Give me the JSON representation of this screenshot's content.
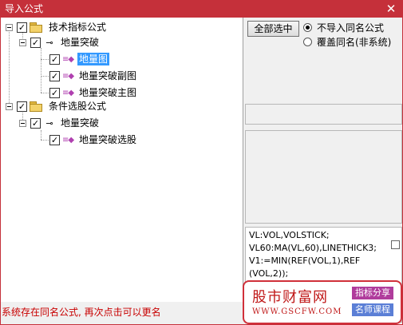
{
  "window": {
    "title": "导入公式",
    "close_glyph": "✕"
  },
  "tree": {
    "nodes": [
      {
        "label": "技术指标公式",
        "checked": true,
        "icon": "folder-icon"
      },
      {
        "label": "地量突破",
        "checked": true,
        "icon": "key-icon"
      },
      {
        "label": "地量图",
        "checked": true,
        "icon": "formula-icon",
        "selected": true
      },
      {
        "label": "地量突破副图",
        "checked": true,
        "icon": "formula-icon"
      },
      {
        "label": "地量突破主图",
        "checked": true,
        "icon": "formula-icon"
      },
      {
        "label": "条件选股公式",
        "checked": true,
        "icon": "folder-icon"
      },
      {
        "label": "地量突破",
        "checked": true,
        "icon": "key-icon"
      },
      {
        "label": "地量突破选股",
        "checked": true,
        "icon": "formula-icon"
      }
    ],
    "check_glyph": "✓",
    "key_glyph": "⊸",
    "formula_glyph": "≡◆"
  },
  "controls": {
    "select_all_label": "全部选中",
    "options": [
      {
        "label": "不导入同名公式",
        "selected": true
      },
      {
        "label": "覆盖同名(非系统)",
        "selected": false
      }
    ]
  },
  "code": {
    "lines": [
      "VL:VOL,VOLSTICK;",
      "VL60:MA(VL,60),LINETHICK3;",
      "V1:=MIN(REF(VOL,1),REF",
      "(VOL,2));"
    ]
  },
  "status": {
    "text": "系统存在同名公式, 再次点击可以更名"
  },
  "watermark": {
    "main": "股市财富网",
    "url": "WWW.GSCFW.COM",
    "tag1": "指标分享",
    "tag2": "名师课程"
  },
  "colors": {
    "titlebar": "#c5303a",
    "selection": "#3399ff",
    "status": "#c80000"
  }
}
